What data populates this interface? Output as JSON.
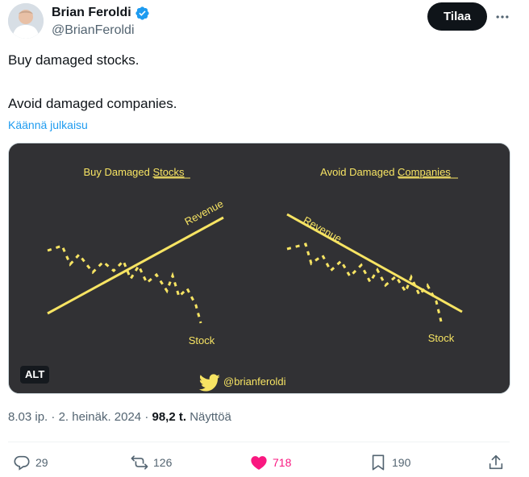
{
  "author": {
    "display_name": "Brian Feroldi",
    "handle": "@BrianFeroldi",
    "verified": true
  },
  "subscribe_label": "Tilaa",
  "more_icon": "more-horizontal-icon",
  "tweet": {
    "lines": [
      "Buy damaged stocks.",
      "Avoid damaged companies."
    ],
    "translate_label": "Käännä julkaisu"
  },
  "image": {
    "left_title_prefix": "Buy Damaged ",
    "left_title_emph": "Stocks",
    "right_title_prefix": "Avoid Damaged ",
    "right_title_emph": "Companies",
    "left_revenue_label": "Revenue",
    "left_stock_label": "Stock",
    "right_revenue_label": "Revenue",
    "right_stock_label": "Stock",
    "watermark": "@brianferoldi",
    "alt_label": "ALT",
    "background_color": "#313134",
    "line_color": "#f7e463"
  },
  "meta": {
    "time": "8.03 ip.",
    "date": "2. heinäk. 2024",
    "views_count": "98,2 t.",
    "views_label": "Näyttöä"
  },
  "actions": {
    "replies": "29",
    "reposts": "126",
    "likes": "718",
    "bookmarks": "190"
  }
}
